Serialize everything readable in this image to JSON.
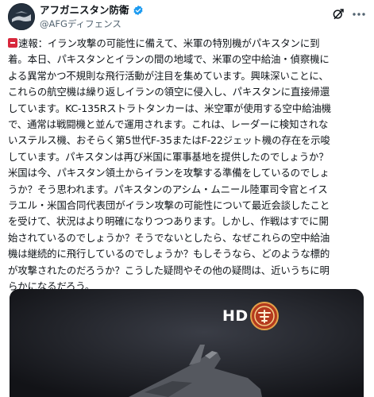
{
  "author": {
    "display_name": "アフガニスタン防衛",
    "handle": "@AFGディフェンス",
    "verified": true
  },
  "actions": {
    "grok_icon": "grok-icon",
    "more_icon": "more-horizontal-icon"
  },
  "tweet": {
    "badge_icon": "red-alert-badge-icon",
    "lines": [
      "速報：イラン攻撃の可能性に備えて、米軍の特別機がパキスタンに到",
      "着。本日、パキスタンとイランの間の地域で、米軍の空中給油・偵察機に",
      "よる異常かつ不規則な飛行活動が注目を集めています。興味深いことに、",
      "これらの航空機は繰り返しイランの領空に侵入し、パキスタンに直接帰還",
      "しています。KC-135Rストラトタンカーは、米空軍が使用する空中給油機",
      "で、通常は戦闘機と並んで運用されます。これは、レーダーに検知されな",
      "いステルス機、おそらく第5世代F-35またはF-22ジェット機の存在を示唆",
      "しています。パキスタンは再び米国に軍事基地を提供したのでしょうか？",
      "米国は今、パキスタン領土からイランを攻撃する準備をしているのでしょ",
      "うか？そう思われます。パキスタンのアシム・ムニール陸軍司令官とイス",
      "ラエル・米国合同代表団がイラン攻撃の可能性について最近会談したこと",
      "を受けて、状況はより明確になりつつあります。しかし、作戦はすでに開",
      "始されているのでしょうか？そうでないとしたら、なぜこれらの空中給油",
      "機は継続的に飛行しているのでしょうか？もしそうなら、どのような標的",
      "が攻撃されたのだろうか？こうした疑問やその他の疑問は、近いうちに明",
      "らかになるだろう。"
    ]
  },
  "media": {
    "overlay_text": "HD",
    "channel_logo_icon": "channel-logo-icon",
    "scene": "fighter-jet-video-frame"
  }
}
